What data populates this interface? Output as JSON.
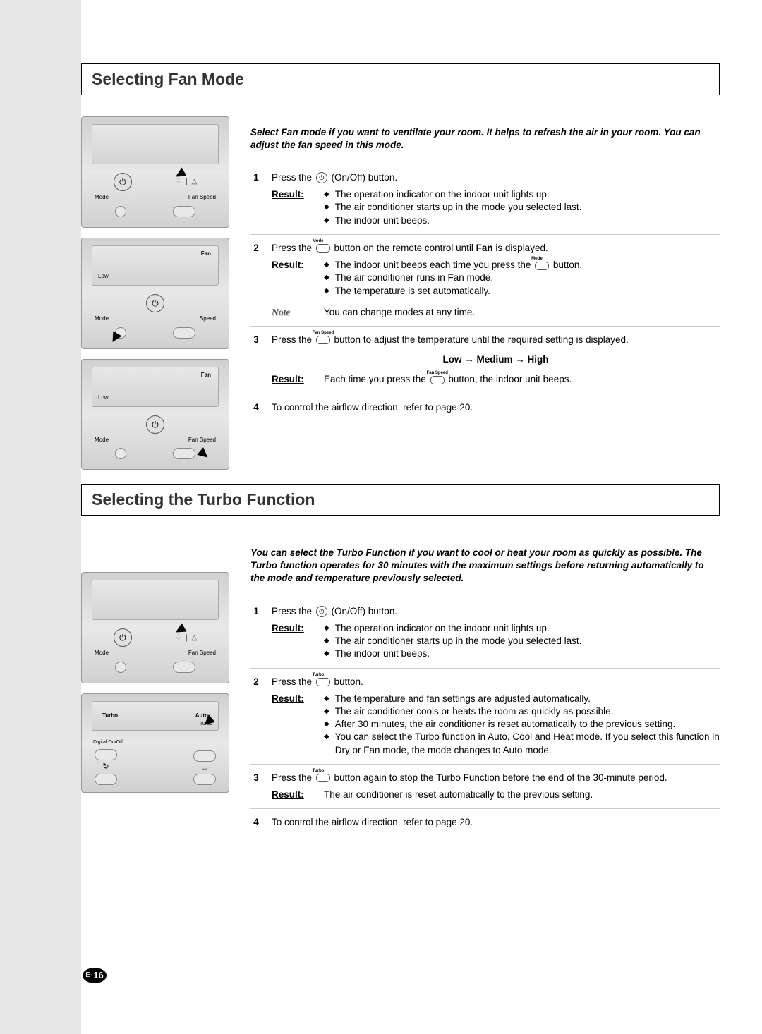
{
  "page_number_prefix": "E-",
  "page_number": "16",
  "section1": {
    "title": "Selecting Fan Mode",
    "intro": "Select Fan mode if you want to ventilate your room. It helps to refresh the air in your room. You can adjust the fan speed in this mode.",
    "steps": [
      {
        "num": "1",
        "text_a": "Press the ",
        "text_b": " (On/Off) button.",
        "result_label": "Result",
        "results": [
          "The operation indicator on the indoor unit lights up.",
          "The air conditioner starts up in the mode you selected last.",
          "The indoor unit beeps."
        ]
      },
      {
        "num": "2",
        "text_a": "Press the ",
        "btn_label": "Mode",
        "text_b": " button on the remote control until ",
        "bold": "Fan",
        "text_c": " is displayed.",
        "result_label": "Result",
        "results": [
          "The indoor unit beeps each time you press the  button.",
          "The air conditioner runs in Fan mode.",
          "The temperature is set automatically."
        ],
        "note_label": "Note",
        "note": "You can change modes at any time."
      },
      {
        "num": "3",
        "text_a": "Press the ",
        "btn_label": "Fan Speed",
        "text_b": " button to adjust the temperature until the required setting is displayed.",
        "sequence": "Low → Medium → High",
        "result_label": "Result",
        "result_text_a": "Each time you press the ",
        "result_btn": "Fan Speed",
        "result_text_b": " button, the indoor unit beeps."
      },
      {
        "num": "4",
        "text": "To control the airflow direction, refer to page 20."
      }
    ],
    "remote_labels": {
      "mode": "Mode",
      "fan_speed": "Fan Speed",
      "fan": "Fan",
      "low": "Low",
      "speed": "Speed"
    }
  },
  "section2": {
    "title": "Selecting the Turbo Function",
    "intro": "You can select the Turbo Function if you want to cool or heat your room as quickly as possible. The Turbo function operates for 30 minutes with the maximum settings before returning automatically to the mode and temperature previously selected.",
    "steps": [
      {
        "num": "1",
        "text_a": "Press the ",
        "text_b": " (On/Off) button.",
        "result_label": "Result",
        "results": [
          "The operation indicator on the indoor unit lights up.",
          "The air conditioner starts up in the mode you selected last.",
          "The indoor unit beeps."
        ]
      },
      {
        "num": "2",
        "text_a": "Press the ",
        "btn_label": "Turbo",
        "text_b": " button.",
        "result_label": "Result",
        "results": [
          "The temperature and fan settings are adjusted automatically.",
          "The air conditioner cools or heats the room as quickly as possible.",
          "After 30 minutes, the air conditioner is reset automatically to the previous setting.",
          "You can select the Turbo function in Auto, Cool and Heat mode. If you select this function in Dry or Fan mode, the mode changes to Auto mode."
        ]
      },
      {
        "num": "3",
        "text_a": "Press the ",
        "btn_label": "Turbo",
        "text_b": " button again to stop the Turbo Function before the end of the 30-minute period.",
        "result_label": "Result",
        "result_plain": "The air conditioner is reset automatically to the previous setting."
      },
      {
        "num": "4",
        "text": "To control the airflow direction, refer to page 20."
      }
    ],
    "remote_labels": {
      "mode": "Mode",
      "fan_speed": "Fan Speed",
      "turbo": "Turbo",
      "auto": "Auto",
      "digital": "Digital On/Off"
    }
  }
}
